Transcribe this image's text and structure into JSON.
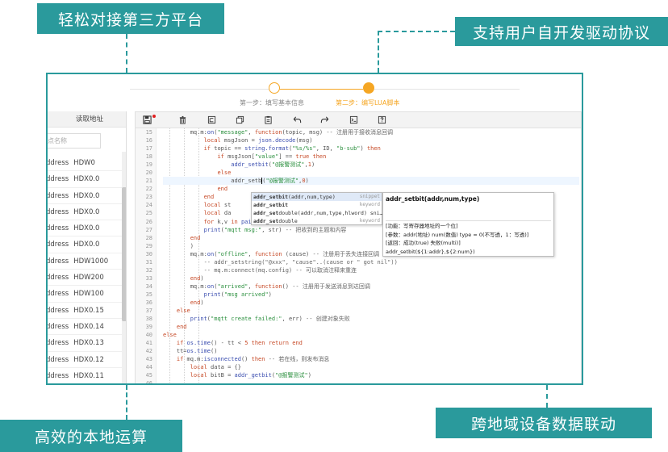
{
  "banners": {
    "top_left": "轻松对接第三方平台",
    "top_right": "支持用户自开发驱动协议",
    "bottom_left": "高效的本地运算",
    "bottom_right": "跨地域设备数据联动"
  },
  "colors": {
    "accent": "#2a9a9c",
    "step_active": "#f5a623"
  },
  "stepper": {
    "step1": "第一步：填写基本信息",
    "step2": "第二步：编写LUA脚本"
  },
  "left_panel": {
    "header": "读取地址",
    "search_placeholder": "点名称",
    "rows": [
      {
        "prefix": "ddress",
        "value": "HDW0"
      },
      {
        "prefix": "ddress",
        "value": "HDX0.0"
      },
      {
        "prefix": "ddress",
        "value": "HDX0.0"
      },
      {
        "prefix": "ddress",
        "value": "HDX0.0"
      },
      {
        "prefix": "ddress",
        "value": "HDX0.0"
      },
      {
        "prefix": "ddress",
        "value": "HDX0.0"
      },
      {
        "prefix": "ddress",
        "value": "HDW1000"
      },
      {
        "prefix": "ddress",
        "value": "HDW200"
      },
      {
        "prefix": "ddress",
        "value": "HDW100"
      },
      {
        "prefix": "ddress",
        "value": "HDX0.15"
      },
      {
        "prefix": "ddress",
        "value": "HDX0.14"
      },
      {
        "prefix": "ddress",
        "value": "HDX0.13"
      },
      {
        "prefix": "ddress",
        "value": "HDX0.12"
      },
      {
        "prefix": "ddress",
        "value": "HDX0.11"
      }
    ]
  },
  "toolbar_icons": [
    "save-icon",
    "delete-icon",
    "import-icon",
    "copy-icon",
    "paste-icon",
    "undo-icon",
    "redo-icon",
    "terminal-icon",
    "help-icon"
  ],
  "editor": {
    "line_numbers": [
      "15",
      "16",
      "17",
      "18",
      "19",
      "20",
      "21",
      "22",
      "23",
      "24",
      "25",
      "26",
      "27",
      "28",
      "29",
      "30",
      "31",
      "32",
      "33",
      "34",
      "35",
      "36",
      "37",
      "38",
      "39",
      "40",
      "41",
      "42",
      "43",
      "44",
      "45",
      "46"
    ],
    "autocomplete": [
      {
        "name": "addr_setbit",
        "rest": "(addr,num,type)",
        "kind": "snippet"
      },
      {
        "name": "addr_setbit",
        "rest": "",
        "kind": "keyword"
      },
      {
        "name": "addr_set",
        "rest": "double(addr,num,type,hlword) sni…",
        "kind": ""
      },
      {
        "name": "addr_set",
        "rest": "double",
        "kind": "keyword"
      }
    ],
    "doc": {
      "title": "addr_setbit(addr,num,type)",
      "lines": [
        "[功能：写寄存器地址的一个位]",
        "[参数：addr(地址)  num(数值)  type = 0(不写透，1：写透)]",
        "[返回：成功(true) 失败(multi)]",
        "addr_setbit(${1:addr},${2:num})"
      ]
    }
  }
}
